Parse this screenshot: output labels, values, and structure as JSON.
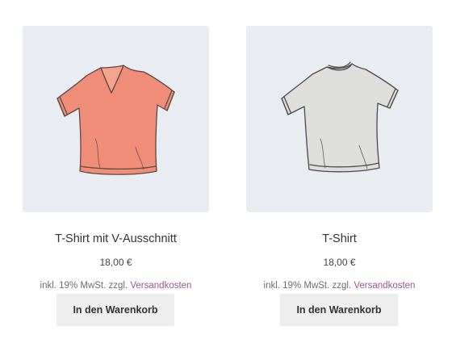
{
  "products": [
    {
      "title": "T-Shirt mit V-Ausschnitt",
      "price": "18,00 €",
      "tax_prefix": "inkl. 19% MwSt. zzgl.",
      "tax_link": "Versandkosten",
      "button_label": "In den Warenkorb",
      "image_icon": "v-neck-tshirt-icon",
      "shirt_color": "#f08d79"
    },
    {
      "title": "T-Shirt",
      "price": "18,00 €",
      "tax_prefix": "inkl. 19% MwSt. zzgl.",
      "tax_link": "Versandkosten",
      "button_label": "In den Warenkorb",
      "image_icon": "tshirt-icon",
      "shirt_color": "#dededc"
    }
  ],
  "colors": {
    "link": "#96588a",
    "image_background": "#e9edf2",
    "button_background": "#eeeeee"
  }
}
